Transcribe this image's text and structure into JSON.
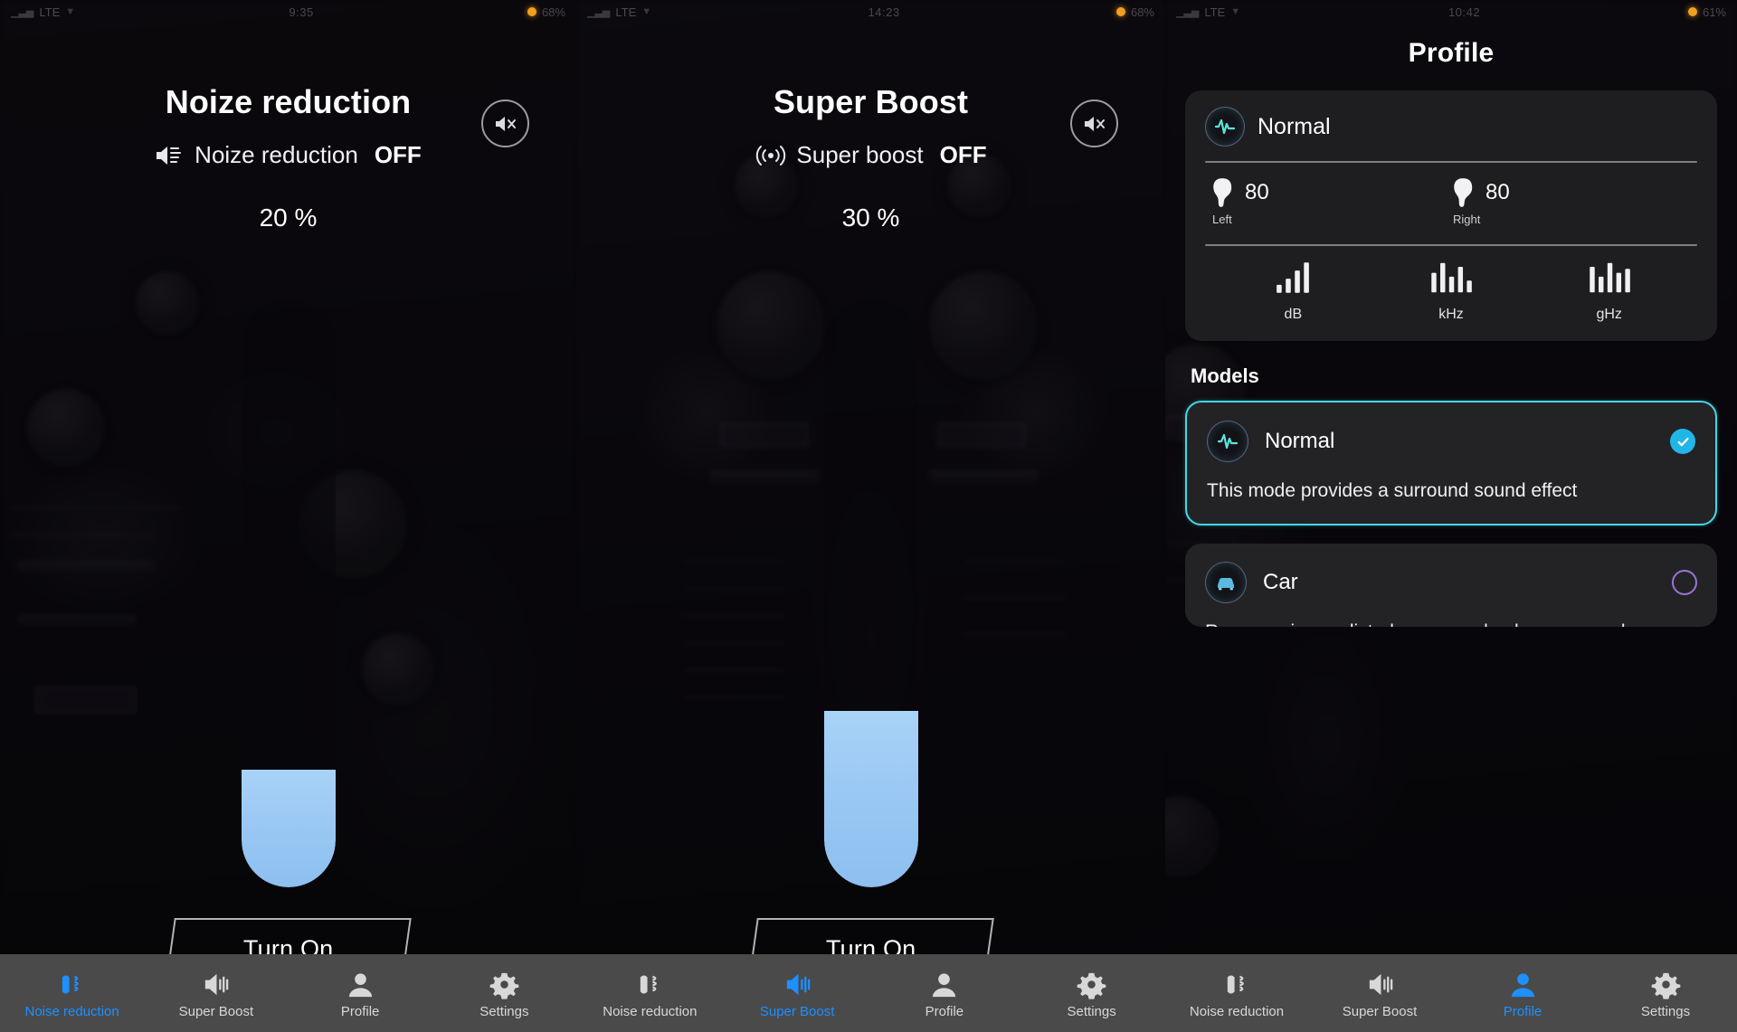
{
  "app": {
    "accent_blue": "#1e90ff",
    "slider_blue": "#9cc9f4",
    "selected_border": "#45d6e8",
    "check_color": "#21b6e8",
    "radio_color": "#9a72d8"
  },
  "panels": [
    {
      "status": {
        "left": "LTE",
        "middle": "9:35",
        "right": "68%"
      },
      "title": "Noize reduction",
      "feature_label": "Noize reduction",
      "feature_state": "OFF",
      "percent": "20 %",
      "slider_value": 20,
      "button_label": "Turn On",
      "mute_icon": "mute-icon",
      "feature_icon": "noise-reduction-icon",
      "nav_active": "Noise reduction"
    },
    {
      "status": {
        "left": "LTE",
        "middle": "14:23",
        "right": "68%"
      },
      "title": "Super Boost",
      "feature_label": "Super boost",
      "feature_state": "OFF",
      "percent": "30 %",
      "slider_value": 30,
      "button_label": "Turn On",
      "mute_icon": "mute-icon",
      "feature_icon": "super-boost-icon",
      "nav_active": "Super Boost"
    },
    {
      "status": {
        "left": "LTE",
        "middle": "10:42",
        "right": "61%"
      },
      "title": "Profile",
      "nav_active": "Profile"
    }
  ],
  "profile": {
    "title": "Profile",
    "current": {
      "name": "Normal",
      "icon": "waveform-icon",
      "left": {
        "label": "Left",
        "value": "80",
        "icon": "ear-icon"
      },
      "right": {
        "label": "Right",
        "value": "80",
        "icon": "ear-icon"
      },
      "bands": [
        {
          "caption": "dB",
          "icon": "equalizer-icon",
          "bars": [
            8,
            14,
            22,
            30
          ]
        },
        {
          "caption": "kHz",
          "icon": "equalizer-icon",
          "bars": [
            20,
            30,
            16,
            26,
            12
          ]
        },
        {
          "caption": "gHz",
          "icon": "equalizer-icon",
          "bars": [
            26,
            16,
            30,
            20,
            24
          ]
        }
      ]
    },
    "models_heading": "Models",
    "models": [
      {
        "name": "Normal",
        "icon": "waveform-icon",
        "description": "This mode provides a surround sound effect",
        "selected": true,
        "control": "checkmark-icon"
      },
      {
        "name": "Car",
        "icon": "car-icon",
        "description": "Removes in-car disturbances and enhances vocals",
        "selected": false,
        "control": "radio-circle"
      }
    ]
  },
  "nav": {
    "items": [
      {
        "label": "Noise reduction",
        "icon": "noise-reduction-icon"
      },
      {
        "label": "Super Boost",
        "icon": "speaker-waves-icon"
      },
      {
        "label": "Profile",
        "icon": "person-icon"
      },
      {
        "label": "Settings",
        "icon": "gear-icon"
      }
    ]
  }
}
